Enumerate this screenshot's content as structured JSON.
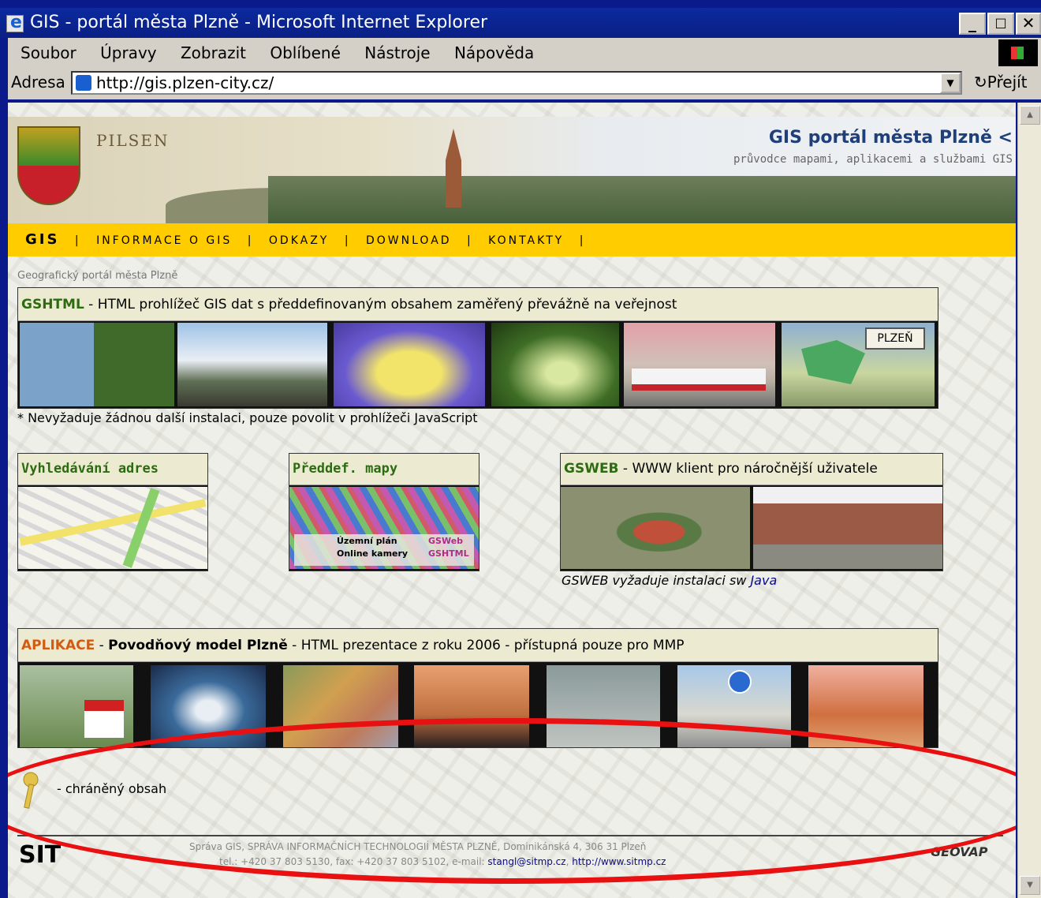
{
  "window": {
    "title": "GIS - portál města Plzně - Microsoft Internet Explorer",
    "min": "_",
    "max": "□",
    "close": "✕"
  },
  "menu": [
    "Soubor",
    "Úpravy",
    "Zobrazit",
    "Oblíbené",
    "Nástroje",
    "Nápověda"
  ],
  "address": {
    "label": "Adresa",
    "url": "http://gis.plzen-city.cz/",
    "go": "Přejít"
  },
  "banner": {
    "title": "GIS portál města Plzně <",
    "subtitle": "průvodce mapami, aplikacemi a službami GIS",
    "pilsen": "PILSEN"
  },
  "nav": {
    "items": [
      "GIS",
      "INFORMACE O GIS",
      "ODKAZY",
      "DOWNLOAD",
      "KONTAKTY"
    ],
    "sep": "|"
  },
  "breadcrumb": "Geografický portál města Plzně",
  "gshtml": {
    "name": "GSHTML",
    "desc": " - HTML prohlížeč GIS dat s předdefinovaným obsahem zaměřený převážně na veřejnost",
    "note": "* Nevyžaduje žádnou další instalaci, pouze povolit v prohlížeči JavaScript",
    "plzen_sign": "PLZEŇ"
  },
  "search": {
    "title": "Vyhledávání adres"
  },
  "predef": {
    "title": "Předdef. mapy",
    "rows": [
      {
        "label": "Územní plán",
        "link": "GSWeb"
      },
      {
        "label": "Online kamery",
        "link": "GSHTML"
      }
    ]
  },
  "gsweb": {
    "name": "GSWEB",
    "desc": " - WWW klient pro náročnější uživatele",
    "note_pre": "GSWEB vyžaduje instalaci sw ",
    "note_link": "Java"
  },
  "aplikace": {
    "name": "APLIKACE",
    "dash": " - ",
    "bold": "Povodňový model Plzně",
    "desc": " - HTML prezentace z roku 2006 - přístupná pouze pro MMP"
  },
  "key_label": "- chráněný obsah",
  "footer": {
    "logo": "SIT",
    "line1": "Správa GIS, SPRÁVA INFORMAČNÍCH TECHNOLOGIÍ MĚSTA PLZNĚ, Dominikánská 4, 306 31 Plzeň",
    "line2_pre": "tel.: +420 37 803 5130, fax: +420 37 803 5102, e-mail: ",
    "email": "stangl@sitmp.cz",
    "comma": ", ",
    "web": "http://www.sitmp.cz",
    "partner": "GEOVAP"
  },
  "colors": {
    "nav": "#ffcc00",
    "header_green": "#2d6b12",
    "highlight_ellipse": "#e81010"
  }
}
